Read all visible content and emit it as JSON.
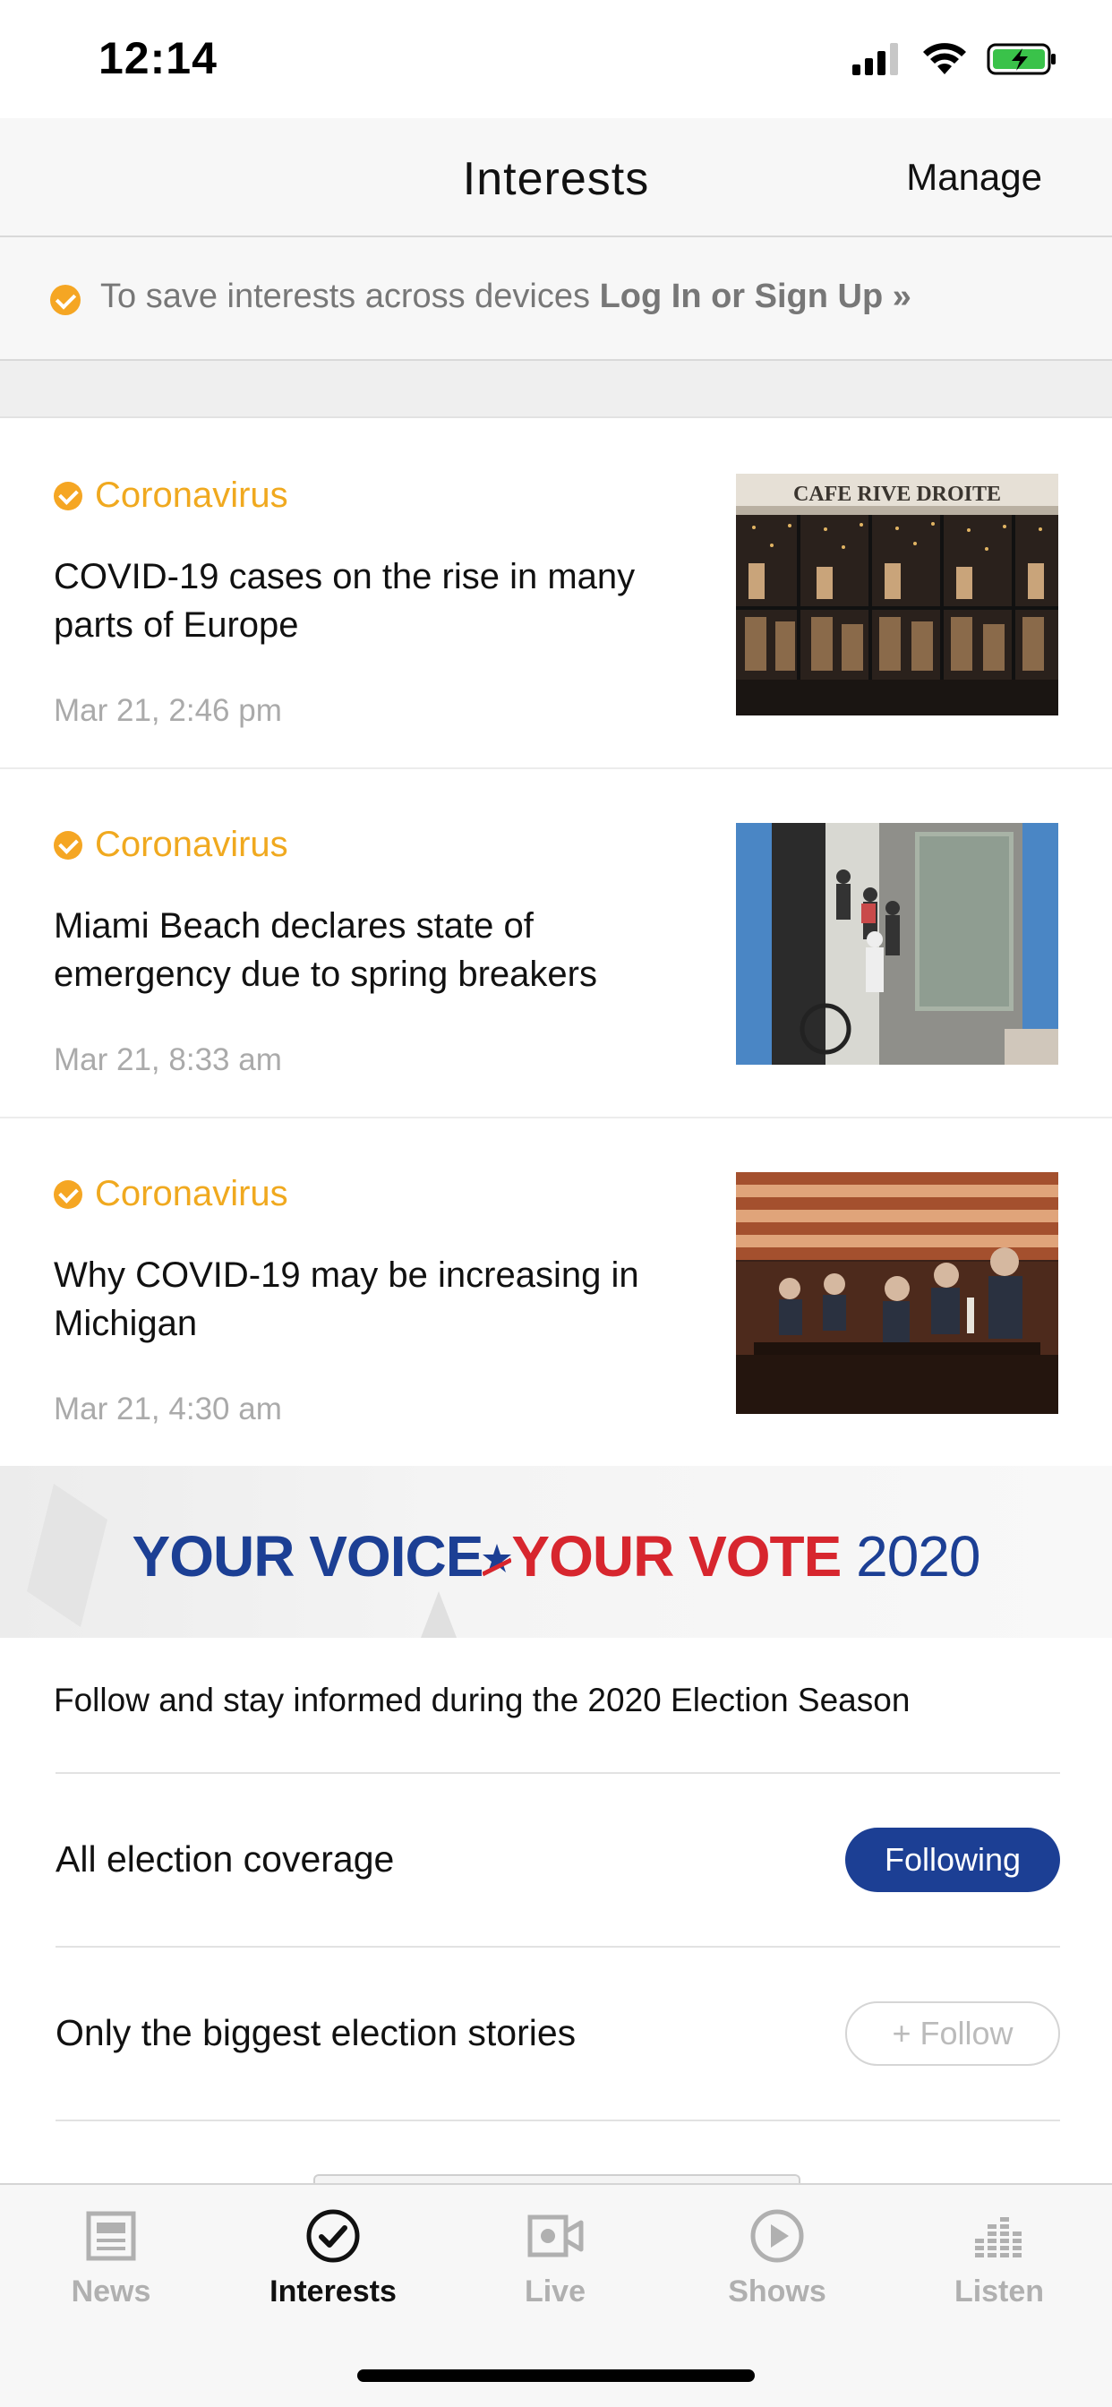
{
  "status_bar": {
    "time": "12:14"
  },
  "nav": {
    "title": "Interests",
    "manage_label": "Manage"
  },
  "login_banner": {
    "text": "To save interests across devices ",
    "link": "Log In or Sign Up »"
  },
  "stories": [
    {
      "tag": "Coronavirus",
      "headline": "COVID-19 cases on the rise in many parts of Europe",
      "date": "Mar 21, 2:46 pm",
      "image_sign": "CAFE RIVE DROITE"
    },
    {
      "tag": "Coronavirus",
      "headline": "Miami Beach declares state of emergency due to spring breakers",
      "date": "Mar 21, 8:33 am"
    },
    {
      "tag": "Coronavirus",
      "headline": "Why COVID-19 may be increasing in Michigan",
      "date": "Mar 21, 4:30 am"
    }
  ],
  "election": {
    "banner": {
      "part1": "YOUR VOICE",
      "part2": "YOUR VOTE",
      "year": "2020"
    },
    "description": "Follow and stay informed during the 2020 Election Season",
    "options": [
      {
        "label": "All election coverage",
        "button": "Following"
      },
      {
        "label": "Only the biggest election stories",
        "button": "+ Follow"
      }
    ]
  },
  "tabs": [
    {
      "label": "News",
      "icon": "newspaper-icon",
      "active": false
    },
    {
      "label": "Interests",
      "icon": "check-circle-icon",
      "active": true
    },
    {
      "label": "Live",
      "icon": "video-camera-icon",
      "active": false
    },
    {
      "label": "Shows",
      "icon": "play-circle-icon",
      "active": false
    },
    {
      "label": "Listen",
      "icon": "audio-bars-icon",
      "active": false
    }
  ],
  "colors": {
    "accent_orange": "#f5a623",
    "brand_blue": "#1c3f94",
    "brand_red": "#d7262e"
  }
}
